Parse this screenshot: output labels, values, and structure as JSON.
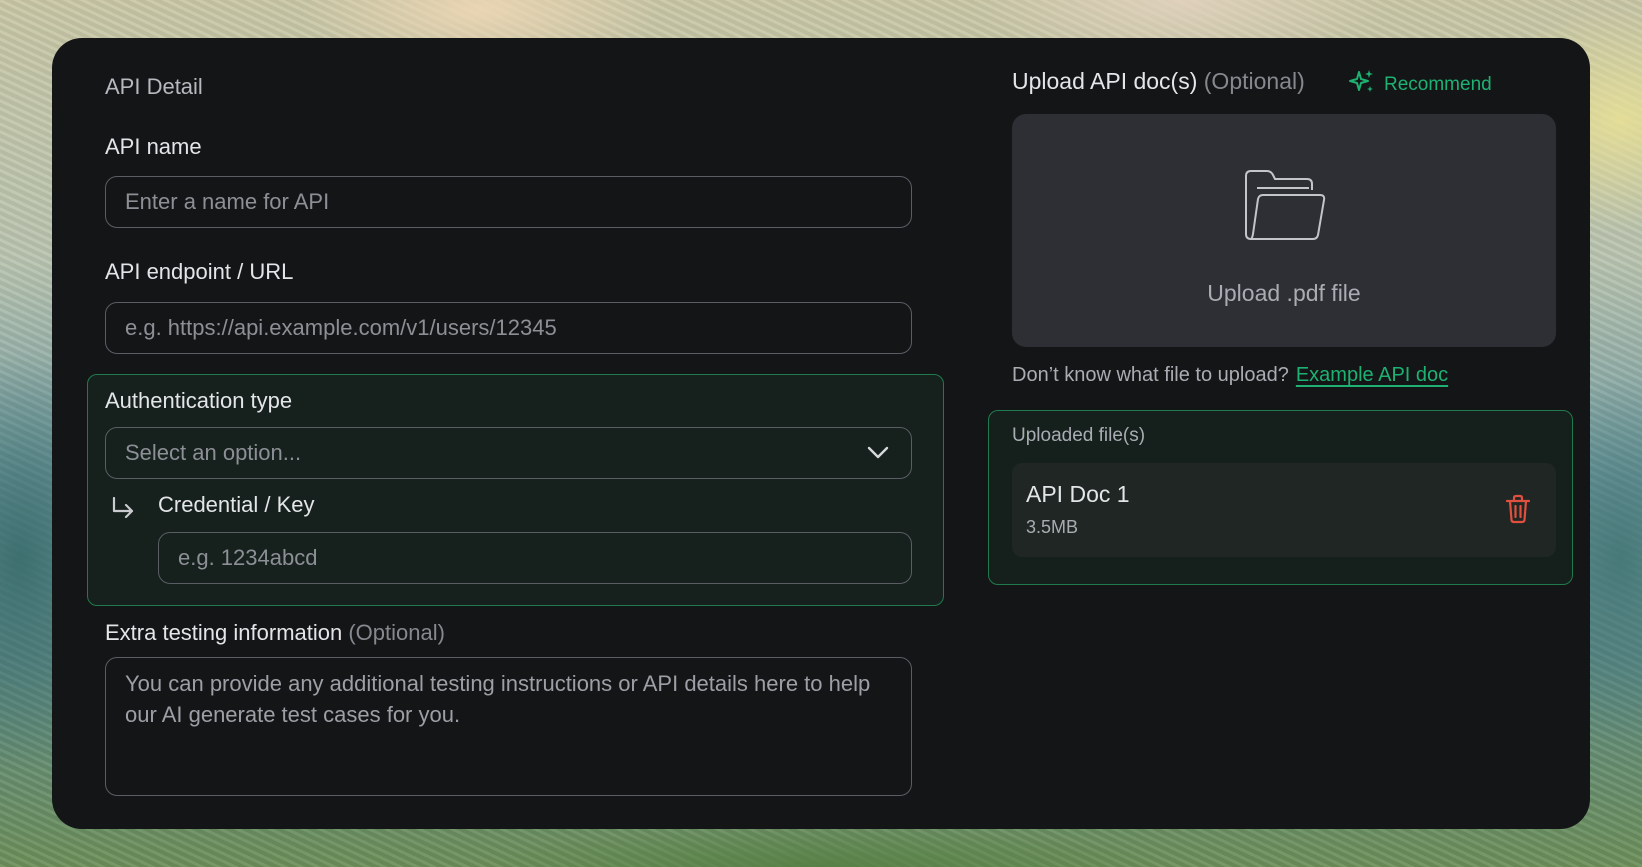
{
  "left": {
    "section_title": "API Detail",
    "api_name": {
      "label": "API name",
      "placeholder": "Enter a name for API"
    },
    "api_endpoint": {
      "label": "API endpoint / URL",
      "placeholder": "e.g. https://api.example.com/v1/users/12345"
    },
    "auth": {
      "label": "Authentication type",
      "select_value": "Select an option...",
      "credential_label": "Credential / Key",
      "credential_placeholder": "e.g. 1234abcd"
    },
    "extra": {
      "label": "Extra testing information",
      "optional": "(Optional)",
      "placeholder": "You can provide any additional testing instructions or API details here to help our AI generate test cases for you."
    }
  },
  "right": {
    "upload_title": "Upload API doc(s)",
    "upload_optional": "(Optional)",
    "recommend_label": "Recommend",
    "upload_box_text": "Upload .pdf file",
    "hint_text": "Don’t know what file to upload?",
    "hint_link": "Example API doc",
    "uploaded_title": "Uploaded file(s)",
    "files": [
      {
        "name": "API Doc 1",
        "size": "3.5MB"
      }
    ]
  },
  "colors": {
    "accent_green": "#1db272",
    "delete_red": "#e0503f",
    "card_bg": "#141517"
  },
  "icons": [
    "sparkle-icon",
    "folder-icon",
    "chevron-down-icon",
    "subdirectory-arrow-icon",
    "trash-icon"
  ]
}
